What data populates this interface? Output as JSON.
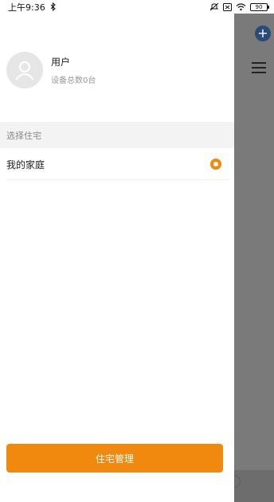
{
  "status_bar": {
    "time": "上午9:36",
    "battery": "90",
    "icons": [
      "bluetooth-icon",
      "mute-icon",
      "sim-card-icon",
      "wifi-icon",
      "battery-icon"
    ]
  },
  "background_page": {
    "icons": [
      "add-icon",
      "menu-icon"
    ],
    "accent_color": "#2a4a78"
  },
  "drawer": {
    "user": {
      "name": "用户",
      "device_count": "设备总数0台"
    },
    "section_title": "选择住宅",
    "homes": [
      {
        "label": "我的家庭",
        "selected": true
      }
    ],
    "manage_button": "住宅管理"
  },
  "colors": {
    "accent": "#f0890e",
    "overlay": "#7a7a7a"
  }
}
